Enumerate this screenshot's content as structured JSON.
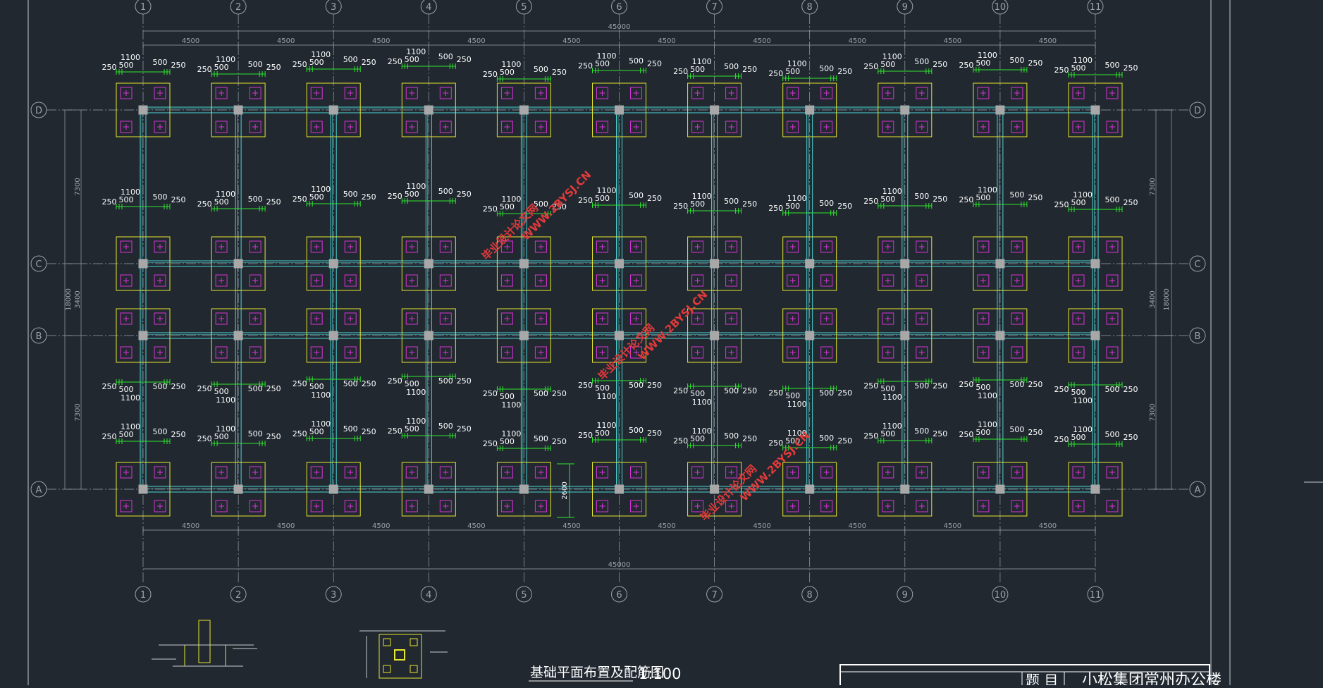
{
  "drawing": {
    "title": "基础平面布置及配筋图",
    "scale": "1:100",
    "title_block_label": "题 目",
    "title_block_project": "小松集团常州办公楼",
    "watermark_line1": "毕业设计论文网",
    "watermark_line2": "WWW.2BYSJ.CN"
  },
  "grid": {
    "columns": [
      "1",
      "2",
      "3",
      "4",
      "5",
      "6",
      "7",
      "8",
      "9",
      "10",
      "11"
    ],
    "rows": [
      "D",
      "C",
      "B",
      "A"
    ],
    "bay_spacing": "4500",
    "total_length": "45000",
    "row_spacings": [
      "7300",
      "3400",
      "7300"
    ],
    "total_depth": "18000",
    "offset_dim": "2600"
  },
  "rebar_labels": {
    "edge": "250",
    "inner": "500",
    "mid": "1100"
  },
  "colors": {
    "background": "#212830",
    "grid_line": "#9aa3ad",
    "footing": "#e6e62e",
    "beam": "#4fd6d6",
    "pile": "#d633d6",
    "rebar": "#2ee62e",
    "column": "#a8a8a8",
    "text": "#ffffff",
    "watermark": "#e23a3a"
  }
}
